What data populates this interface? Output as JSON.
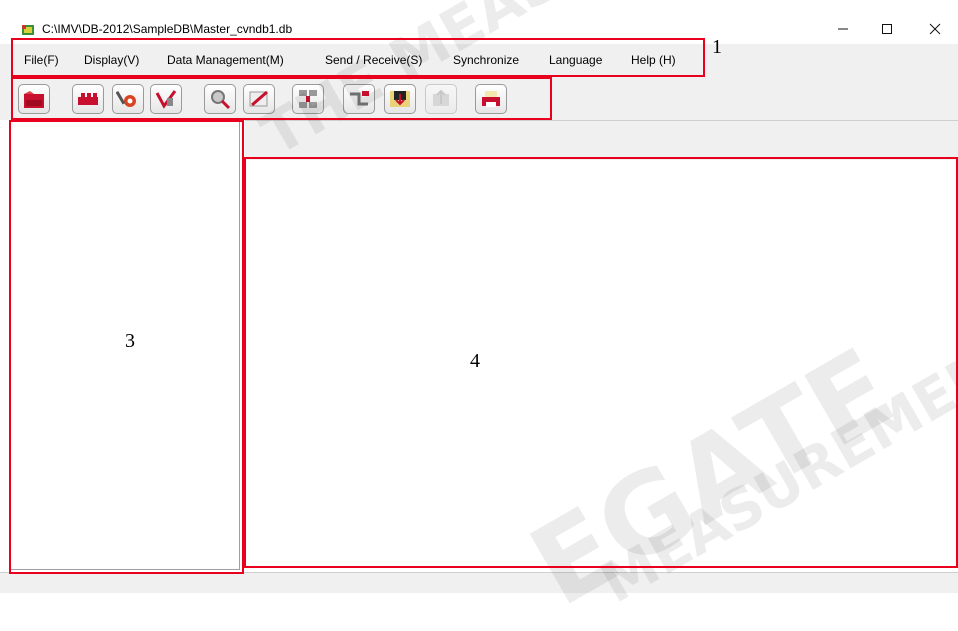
{
  "window": {
    "title": "C:\\IMV\\DB-2012\\SampleDB\\Master_cvndb1.db",
    "minimize_glyph": "—",
    "maximize_glyph": "☐",
    "close_glyph": "✕"
  },
  "menu": {
    "items": [
      {
        "label": "File(F)"
      },
      {
        "label": "Display(V)"
      },
      {
        "label": "Data Management(M)"
      },
      {
        "label": "Send / Receive(S)"
      },
      {
        "label": "Synchronize"
      },
      {
        "label": "Language"
      },
      {
        "label": "Help (H)"
      }
    ]
  },
  "toolbar": {
    "buttons": [
      {
        "icon": "open-folder-icon"
      },
      {
        "icon": "blocks-icon"
      },
      {
        "icon": "tools-gear-icon"
      },
      {
        "icon": "check-mark-icon"
      },
      {
        "icon": "magnifier-icon"
      },
      {
        "icon": "edit-pencil-icon"
      },
      {
        "icon": "database-icon"
      },
      {
        "icon": "connect-icon"
      },
      {
        "icon": "download-icon"
      },
      {
        "icon": "upload-icon",
        "disabled": true
      },
      {
        "icon": "printer-icon"
      }
    ]
  },
  "annotations": {
    "menu_label": "1",
    "left_pane_label": "3",
    "right_pane_label": "4",
    "color": "#e8001c"
  },
  "watermark": {
    "text_1": "THE MEASUREMENT",
    "text_2": "EGATE",
    "text_3": "MEASUREMENT"
  }
}
